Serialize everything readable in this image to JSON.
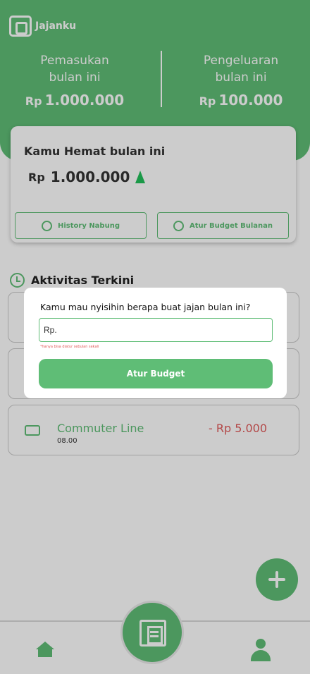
{
  "app": {
    "name": "Jajanku"
  },
  "header": {
    "income": {
      "title": "Pemasukan\nbulan ini",
      "currency": "Rp",
      "value": "1.000.000"
    },
    "expense": {
      "title": "Pengeluaran\nbulan ini",
      "currency": "Rp",
      "value": "100.000"
    }
  },
  "savings_card": {
    "title": "Kamu Hemat bulan ini",
    "currency": "Rp",
    "value": "1.000.000",
    "buttons": {
      "history": "History Nabung",
      "budget": "Atur Budget Bulanan"
    }
  },
  "activities": {
    "title": "Aktivitas Terkini",
    "items": [
      {
        "name": "",
        "time": "",
        "amount": ""
      },
      {
        "name": "",
        "time": "",
        "amount": ""
      },
      {
        "name": "Commuter Line",
        "time": "08.00",
        "amount": "- Rp 5.000"
      }
    ]
  },
  "modal": {
    "question": "Kamu mau nyisihin berapa buat jajan bulan ini?",
    "input_placeholder": "Rp.",
    "hint": "*hanya bisa diatur sebulan sekali",
    "submit_label": "Atur Budget"
  },
  "colors": {
    "accent": "#5fbd76",
    "danger": "#e05a5a"
  },
  "icons": [
    "wallet-icon",
    "money-bag-icon",
    "refresh-money-icon",
    "history-icon",
    "train-icon",
    "plus-icon",
    "home-icon",
    "scan-icon",
    "user-icon",
    "tree-icon"
  ]
}
